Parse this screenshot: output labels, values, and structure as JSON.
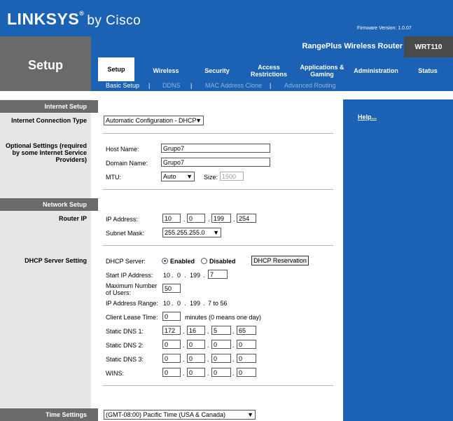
{
  "brand": {
    "logo": "LINKSYS",
    "reg": "®",
    "suffix": "by Cisco",
    "firmware": "Firmware Version: 1.0.07"
  },
  "router_name": "RangePlus Wireless Router",
  "model": "WRT110",
  "page_label": "Setup",
  "tabs": [
    "Setup",
    "Wireless",
    "Security",
    "Access Restrictions",
    "Applications & Gaming",
    "Administration",
    "Status"
  ],
  "subtabs": [
    "Basic Setup",
    "DDNS",
    "MAC Address Clone",
    "Advanced Routing"
  ],
  "help_link": "Help...",
  "internet_setup": {
    "header": "Internet Setup",
    "connection_type_label": "Internet Connection Type",
    "connection_type_value": "Automatic Configuration - DHCP",
    "optional_label": "Optional Settings (required by some Internet Service Providers)",
    "host_name_label": "Host Name:",
    "host_name": "Grupo7",
    "domain_name_label": "Domain Name:",
    "domain_name": "Grupo7",
    "mtu_label": "MTU:",
    "mtu_value": "Auto",
    "size_label": "Size:",
    "size_value": "1500"
  },
  "network_setup": {
    "header": "Network Setup",
    "router_ip_label": "Router IP",
    "ip_label": "IP Address:",
    "ip": [
      "10",
      "0",
      "199",
      "254"
    ],
    "subnet_label": "Subnet Mask:",
    "subnet_value": "255.255.255.0"
  },
  "dhcp": {
    "section_label": "DHCP Server Setting",
    "server_label": "DHCP Server:",
    "enabled_label": "Enabled",
    "disabled_label": "Disabled",
    "reservation_button": "DHCP Reservation",
    "start_ip_label": "Start IP Address:",
    "start_ip_prefix": [
      "10",
      "0",
      "199"
    ],
    "start_ip_last": "7",
    "max_users_label": "Maximum Number of Users:",
    "max_users": "50",
    "range_label": "IP Address Range:",
    "range_prefix": [
      "10",
      "0",
      "199"
    ],
    "range_text": "7 to 56",
    "lease_label": "Client Lease Time:",
    "lease_value": "0",
    "lease_suffix": "minutes (0 means one day)",
    "dns1_label": "Static DNS 1:",
    "dns1": [
      "172",
      "16",
      "5",
      "65"
    ],
    "dns2_label": "Static DNS 2:",
    "dns2": [
      "0",
      "0",
      "0",
      "0"
    ],
    "dns3_label": "Static DNS 3:",
    "dns3": [
      "0",
      "0",
      "0",
      "0"
    ],
    "wins_label": "WINS:",
    "wins": [
      "0",
      "0",
      "0",
      "0"
    ]
  },
  "time_settings": {
    "header": "Time Settings",
    "timezone": "(GMT-08:00) Pacific Time (USA & Canada)"
  }
}
